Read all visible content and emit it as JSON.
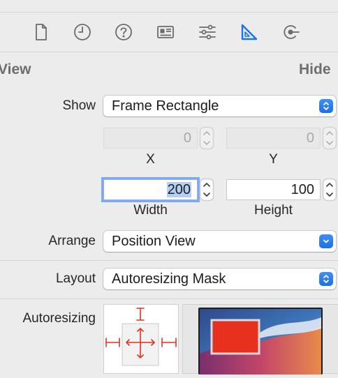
{
  "toolbar": {
    "tabs": [
      {
        "name": "file-inspector",
        "icon": "document-icon"
      },
      {
        "name": "history-inspector",
        "icon": "clock-icon"
      },
      {
        "name": "quick-help",
        "icon": "question-icon"
      },
      {
        "name": "identity-inspector",
        "icon": "id-card-icon"
      },
      {
        "name": "attributes-inspector",
        "icon": "sliders-icon"
      },
      {
        "name": "size-inspector",
        "icon": "ruler-icon",
        "active": true
      },
      {
        "name": "connections-inspector",
        "icon": "connection-icon"
      }
    ],
    "active_color": "#1a73e8"
  },
  "section": {
    "title": "View",
    "hide_label": "Hide"
  },
  "show": {
    "label": "Show",
    "value": "Frame Rectangle"
  },
  "position": {
    "x": {
      "value": "0",
      "caption": "X"
    },
    "y": {
      "value": "0",
      "caption": "Y"
    }
  },
  "size": {
    "width": {
      "value": "200",
      "caption": "Width"
    },
    "height": {
      "value": "100",
      "caption": "Height"
    }
  },
  "arrange": {
    "label": "Arrange",
    "value": "Position View"
  },
  "layout": {
    "label": "Layout",
    "value": "Autoresizing Mask"
  },
  "autoresizing": {
    "label": "Autoresizing",
    "strut_color": "#e0331f",
    "preview_color": "#e8301f"
  }
}
